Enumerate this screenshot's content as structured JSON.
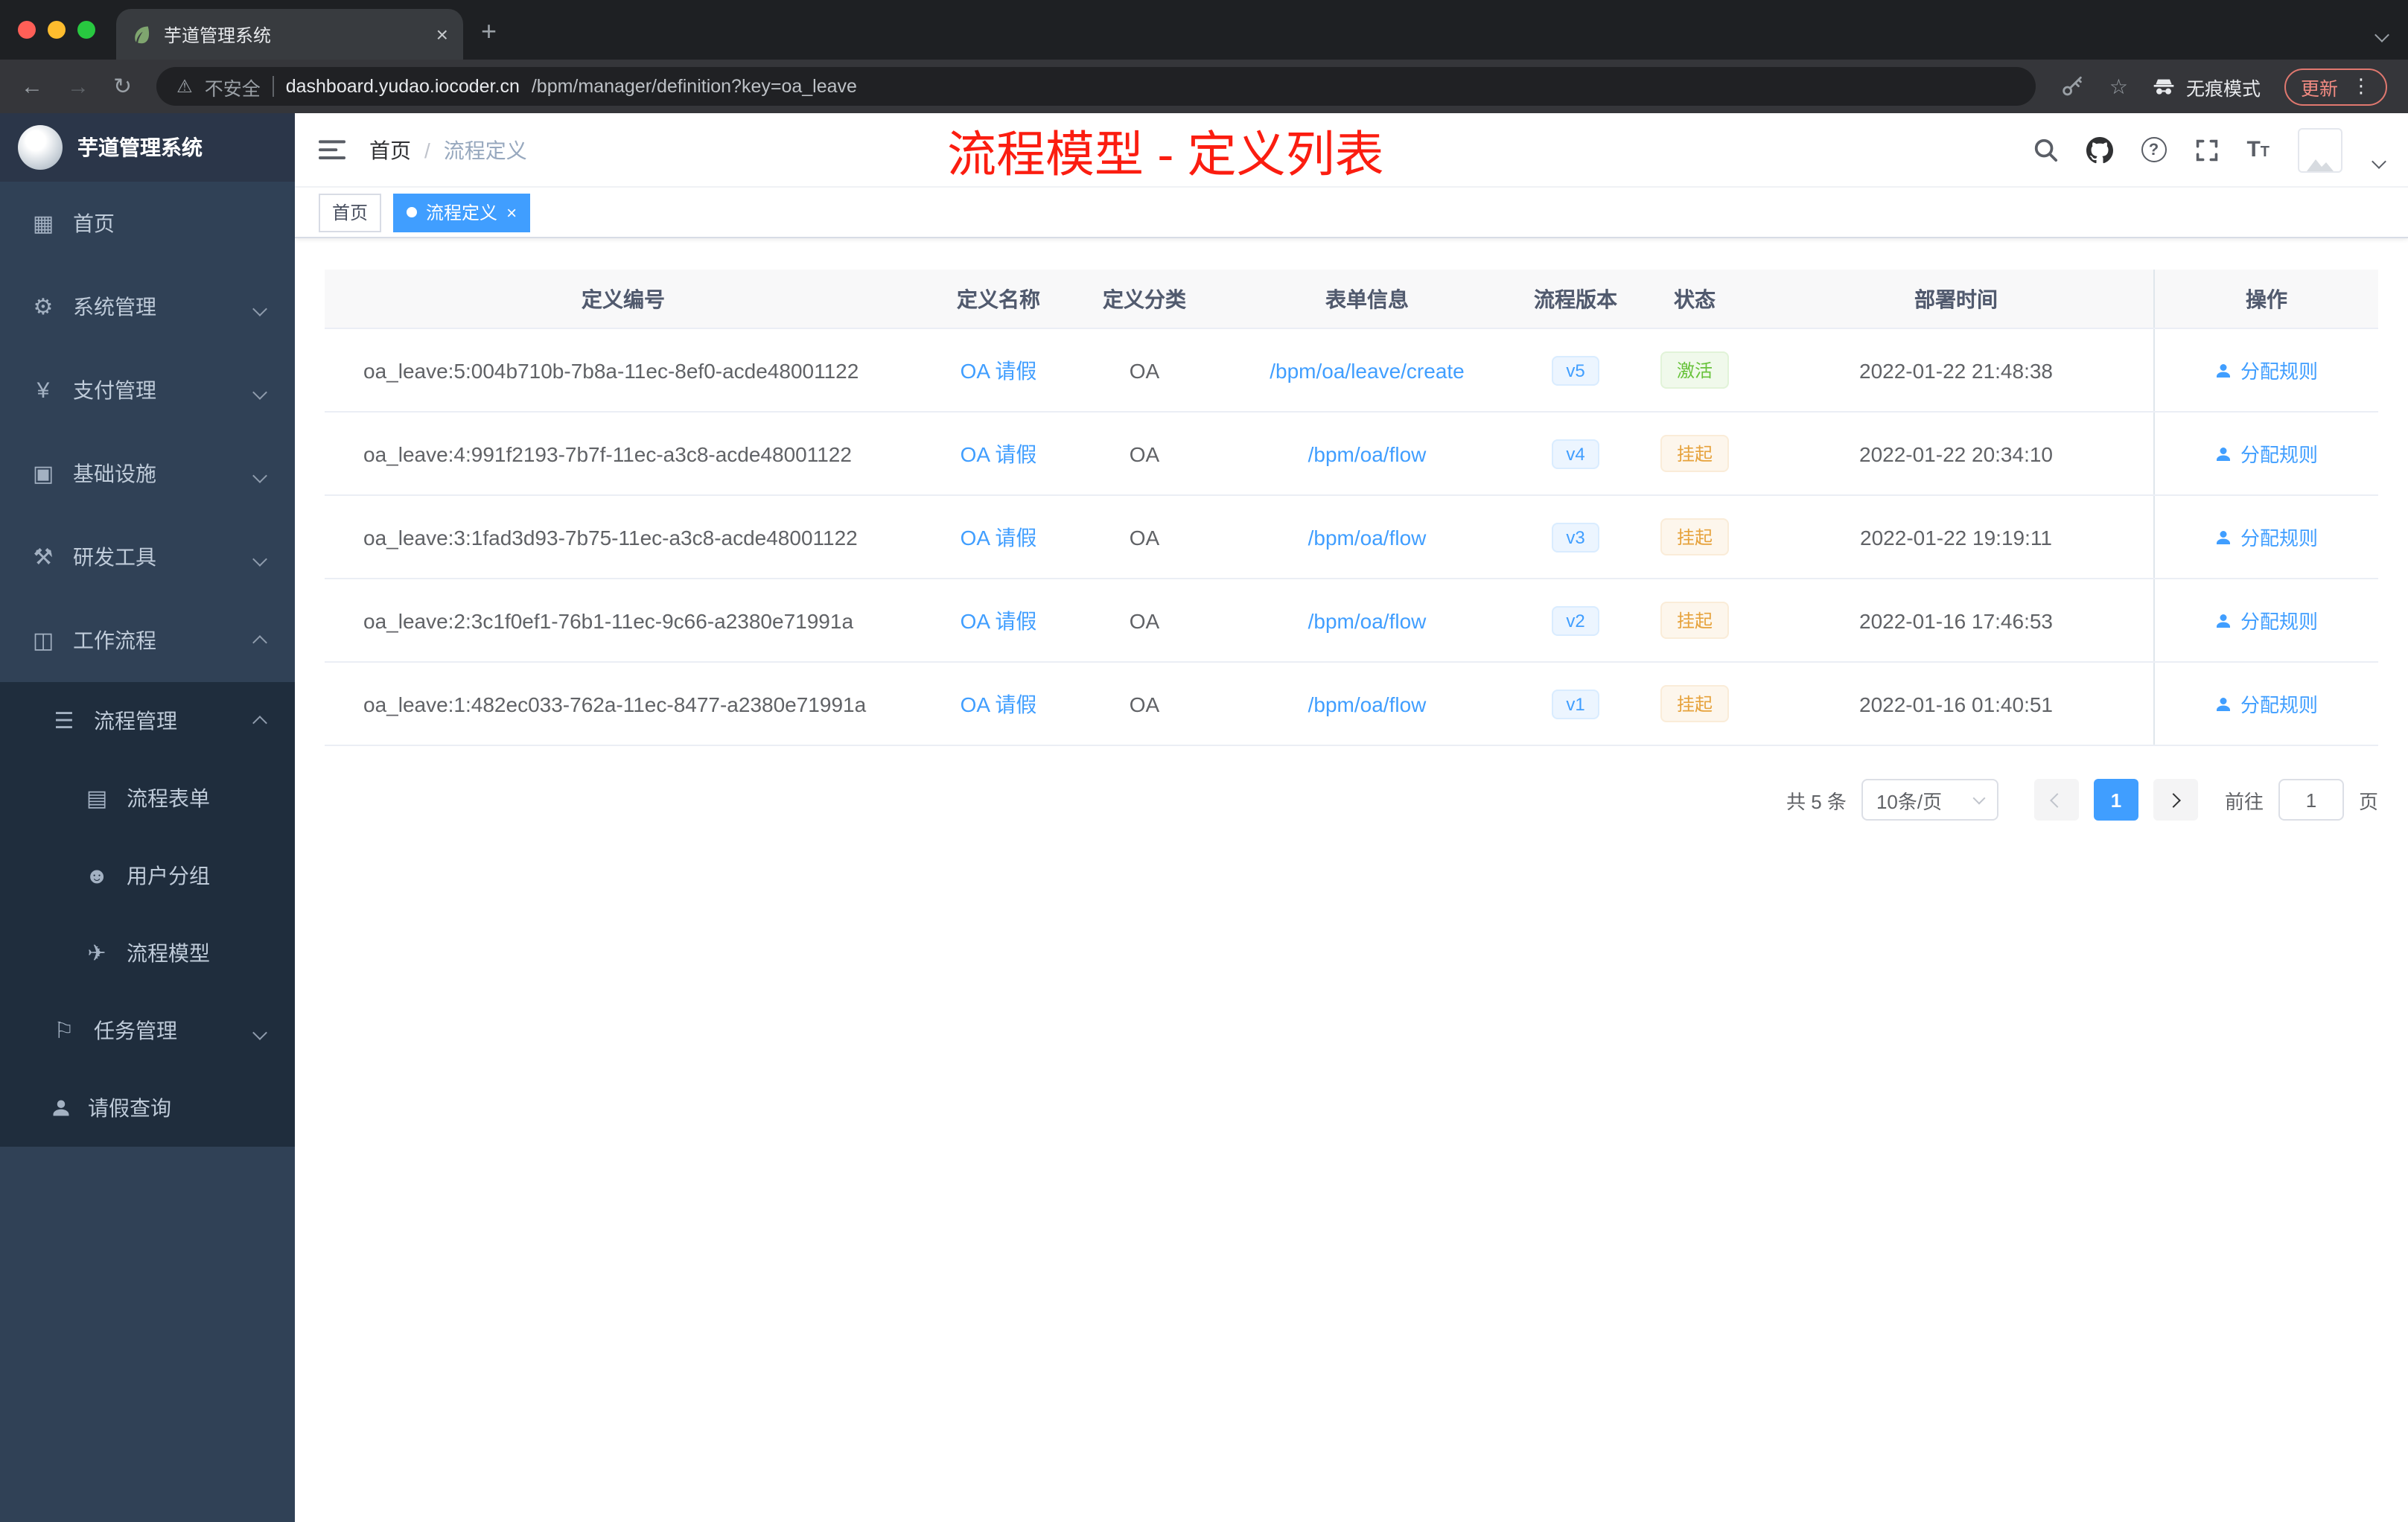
{
  "colors": {
    "primary": "#409eff",
    "annotation_red": "#fb1d10",
    "success": "#67c23a",
    "warning": "#e6a23c",
    "sidebar_bg": "#304156",
    "submenu_bg": "#1f2d3d"
  },
  "browser": {
    "tab_title": "芋道管理系统",
    "security_label": "不安全",
    "url_domain": "dashboard.yudao.iocoder.cn",
    "url_path": "/bpm/manager/definition?key=oa_leave",
    "incognito_label": "无痕模式",
    "update_label": "更新"
  },
  "sidebar": {
    "app_title": "芋道管理系统",
    "menu": [
      {
        "label": "首页"
      },
      {
        "label": "系统管理"
      },
      {
        "label": "支付管理"
      },
      {
        "label": "基础设施"
      },
      {
        "label": "研发工具"
      },
      {
        "label": "工作流程"
      },
      {
        "label": "流程管理"
      },
      {
        "label": "流程表单"
      },
      {
        "label": "用户分组"
      },
      {
        "label": "流程模型"
      },
      {
        "label": "任务管理"
      },
      {
        "label": "请假查询"
      }
    ],
    "glyphs": {
      "dashboard": "▦",
      "gear": "⚙",
      "yen": "¥",
      "infra": "▣",
      "tools": "⚒",
      "workflow": "◫",
      "list": "☰",
      "form": "▤",
      "group": "☻",
      "model": "✈",
      "task": "⚐"
    }
  },
  "navbar": {
    "breadcrumb_home": "首页",
    "breadcrumb_sep": "/",
    "breadcrumb_current": "流程定义",
    "annotation_title": "流程模型 - 定义列表"
  },
  "tags": {
    "home": "首页",
    "active": "流程定义",
    "close": "×"
  },
  "table": {
    "columns": [
      "定义编号",
      "定义名称",
      "定义分类",
      "表单信息",
      "流程版本",
      "状态",
      "部署时间",
      "操作"
    ],
    "rows": [
      {
        "id": "oa_leave:5:004b710b-7b8a-11ec-8ef0-acde48001122",
        "name": "OA 请假",
        "category": "OA",
        "form": "/bpm/oa/leave/create",
        "version": "v5",
        "status": "激活",
        "time": "2022-01-22 21:48:38",
        "action": "分配规则"
      },
      {
        "id": "oa_leave:4:991f2193-7b7f-11ec-a3c8-acde48001122",
        "name": "OA 请假",
        "category": "OA",
        "form": "/bpm/oa/flow",
        "version": "v4",
        "status": "挂起",
        "time": "2022-01-22 20:34:10",
        "action": "分配规则"
      },
      {
        "id": "oa_leave:3:1fad3d93-7b75-11ec-a3c8-acde48001122",
        "name": "OA 请假",
        "category": "OA",
        "form": "/bpm/oa/flow",
        "version": "v3",
        "status": "挂起",
        "time": "2022-01-22 19:19:11",
        "action": "分配规则"
      },
      {
        "id": "oa_leave:2:3c1f0ef1-76b1-11ec-9c66-a2380e71991a",
        "name": "OA 请假",
        "category": "OA",
        "form": "/bpm/oa/flow",
        "version": "v2",
        "status": "挂起",
        "time": "2022-01-16 17:46:53",
        "action": "分配规则"
      },
      {
        "id": "oa_leave:1:482ec033-762a-11ec-8477-a2380e71991a",
        "name": "OA 请假",
        "category": "OA",
        "form": "/bpm/oa/flow",
        "version": "v1",
        "status": "挂起",
        "time": "2022-01-16 01:40:51",
        "action": "分配规则"
      }
    ]
  },
  "pagination": {
    "total": "共 5 条",
    "page_size": "10条/页",
    "current_page": "1",
    "goto_label": "前往",
    "goto_value": "1",
    "page_unit": "页"
  }
}
